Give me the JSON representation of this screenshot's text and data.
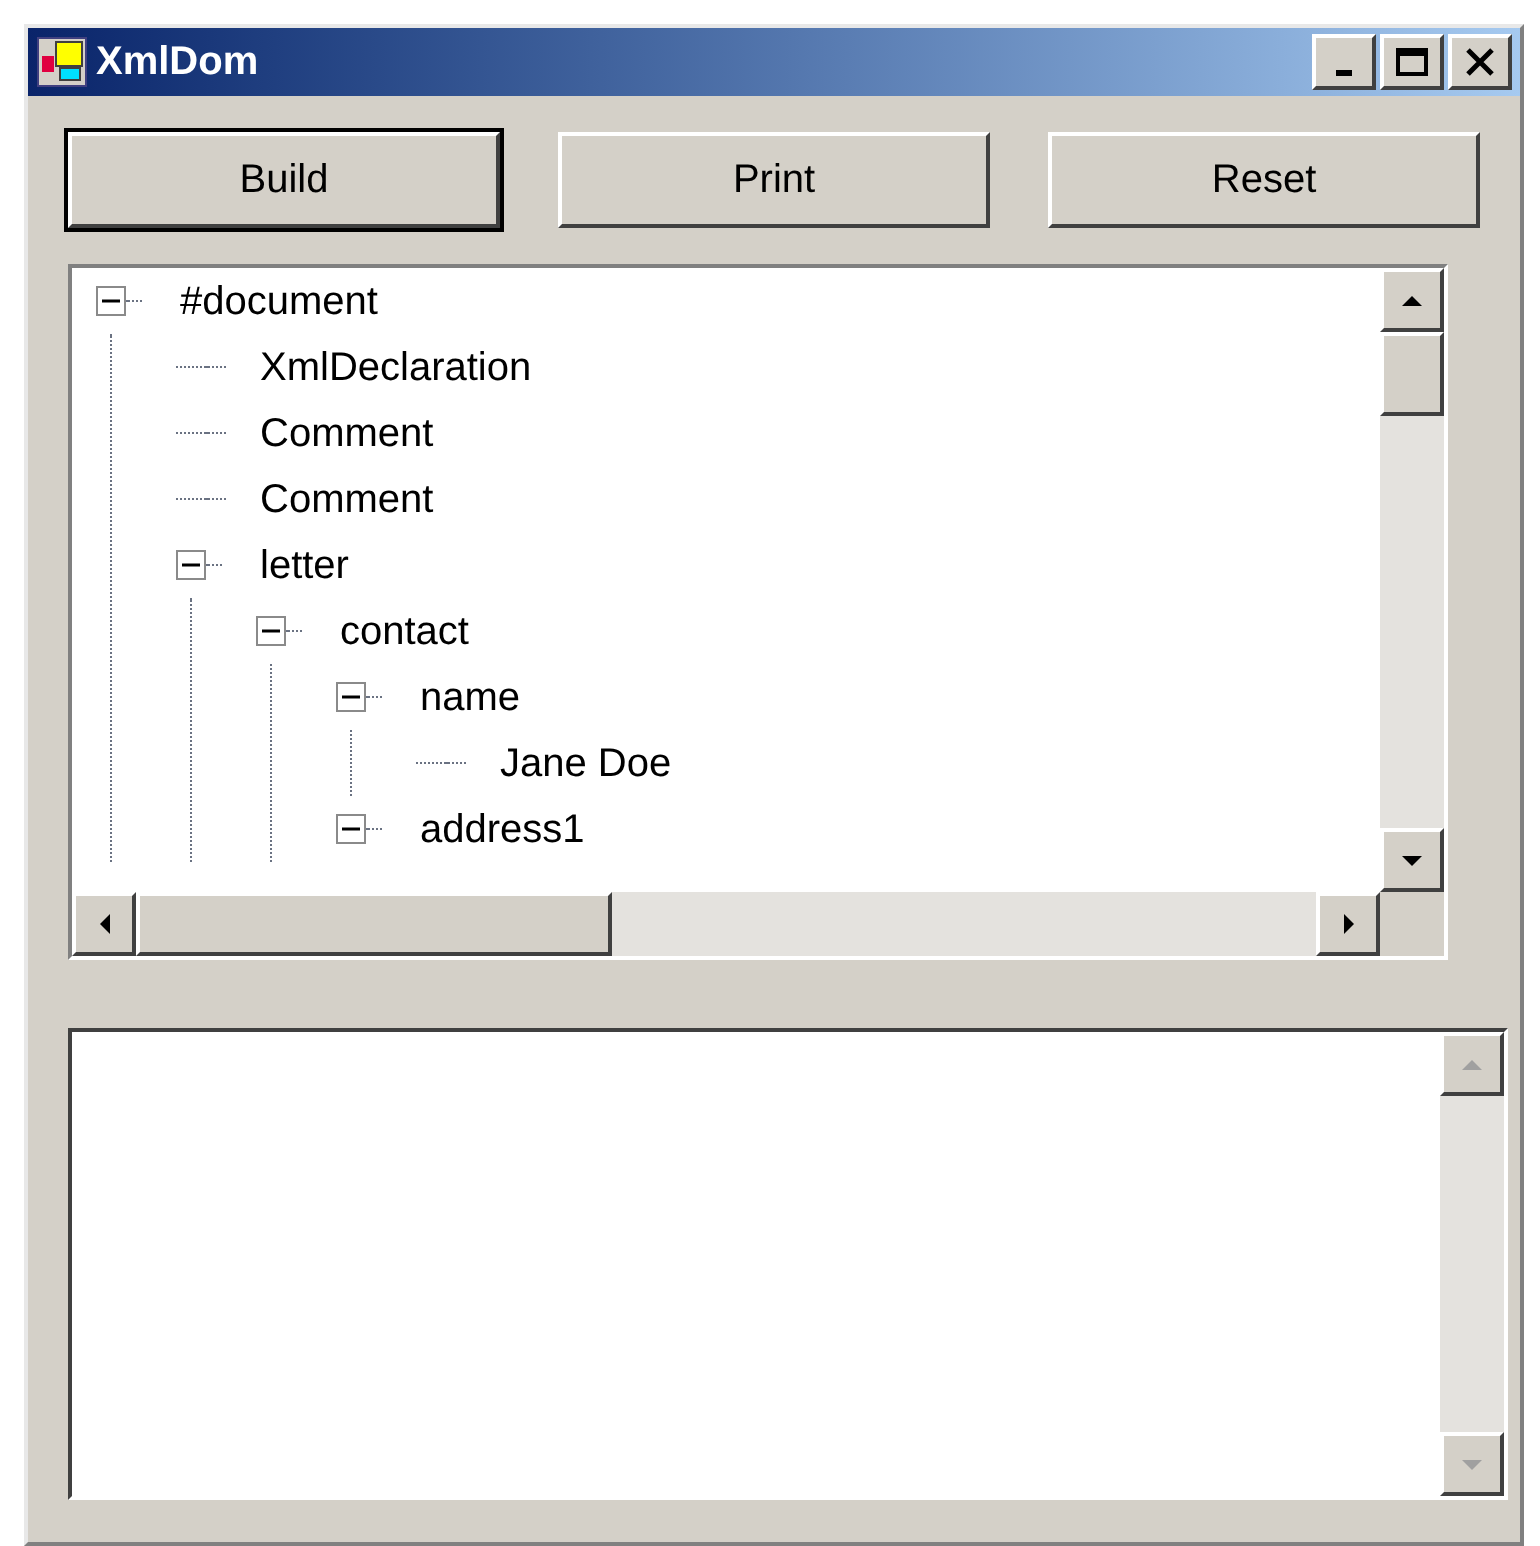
{
  "window": {
    "title": "XmlDom"
  },
  "buttons": [
    {
      "label": "Build",
      "selected": true
    },
    {
      "label": "Print",
      "selected": false
    },
    {
      "label": "Reset",
      "selected": false
    }
  ],
  "tree": {
    "nodes": [
      {
        "label": "#document",
        "expanded": true,
        "children": [
          {
            "label": "XmlDeclaration"
          },
          {
            "label": "Comment"
          },
          {
            "label": "Comment"
          },
          {
            "label": "letter",
            "expanded": true,
            "children": [
              {
                "label": "contact",
                "expanded": true,
                "children": [
                  {
                    "label": "name",
                    "expanded": true,
                    "children": [
                      {
                        "label": "Jane Doe"
                      }
                    ]
                  },
                  {
                    "label": "address1",
                    "expanded": true
                  }
                ]
              }
            ]
          }
        ]
      }
    ]
  }
}
